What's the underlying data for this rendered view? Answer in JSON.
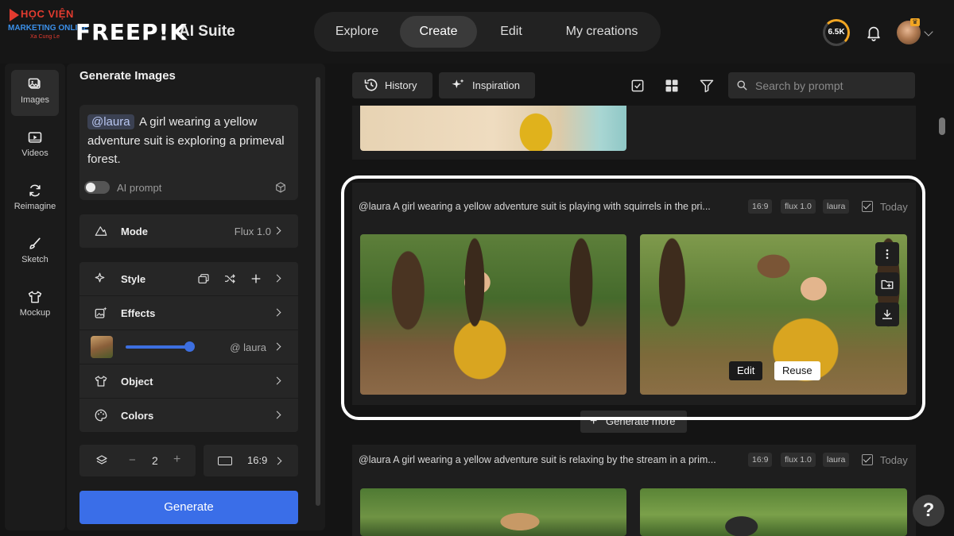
{
  "watermark": {
    "line1": "HỌC VIỆN",
    "line2": "MARKETING ONLINE",
    "line3": "Xa Cung Le"
  },
  "header": {
    "brand": "FREEP!K",
    "suite": "AI Suite",
    "nav": [
      "Explore",
      "Create",
      "Edit",
      "My creations"
    ],
    "active_nav": "Create",
    "credits": "6.5K",
    "accent": "#f2a623"
  },
  "rail": {
    "items": [
      {
        "label": "Images",
        "icon": "image-icon"
      },
      {
        "label": "Videos",
        "icon": "video-icon"
      },
      {
        "label": "Reimagine",
        "icon": "refresh-icon"
      },
      {
        "label": "Sketch",
        "icon": "brush-icon"
      },
      {
        "label": "Mockup",
        "icon": "shirt-icon"
      }
    ]
  },
  "panel": {
    "title": "Generate Images",
    "prompt_mention": "@laura",
    "prompt_text": "A girl wearing a yellow adventure suit is exploring a primeval forest.",
    "ai_prompt_label": "AI prompt",
    "ai_prompt_on": false,
    "mode_label": "Mode",
    "mode_value": "Flux 1.0",
    "style_label": "Style",
    "effects_label": "Effects",
    "character_value": "@ laura",
    "character_strength": 0.95,
    "object_label": "Object",
    "colors_label": "Colors",
    "count": "2",
    "ratio": "16:9",
    "generate_label": "Generate",
    "primary_color": "#3a6ee8"
  },
  "results": {
    "history_label": "History",
    "inspiration_label": "Inspiration",
    "search_placeholder": "Search by prompt",
    "generations": [
      {
        "prompt": "@laura A girl wearing a yellow adventure suit is playing with squirrels in the pri...",
        "tags": [
          "16:9",
          "flux 1.0",
          "laura"
        ],
        "date": "Today",
        "actions": {
          "edit": "Edit",
          "reuse": "Reuse"
        }
      },
      {
        "prompt": "@laura A girl wearing a yellow adventure suit is relaxing by the stream in a prim...",
        "tags": [
          "16:9",
          "flux 1.0",
          "laura"
        ],
        "date": "Today"
      }
    ],
    "generate_more": "Generate more"
  },
  "help_label": "?"
}
